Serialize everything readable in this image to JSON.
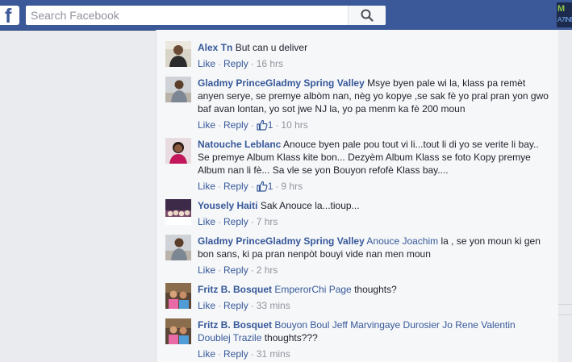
{
  "search": {
    "placeholder": "Search Facebook",
    "logo_letter": "f"
  },
  "corner_badge": {
    "line1": "M",
    "line2": "A7INE"
  },
  "actions": {
    "like": "Like",
    "reply": "Reply",
    "sep": "·"
  },
  "colors": {
    "topbar": "#3b5998",
    "link": "#365899",
    "meta": "#90949c",
    "panel": "#f6f7f9"
  },
  "comments": [
    {
      "author": "Alex Tn",
      "text": "But can u deliver",
      "likes": "",
      "time": "16 hrs"
    },
    {
      "author": "Gladmy PrinceGladmy Spring Valley",
      "text": "Msye byen pale wi la, klass pa remèt anyen serye, se premye albòm nan, nèg yo kopye ,se sak fè yo pral pran yon gwo baf avan lontan, yo sot jwe NJ la, yo pa menm ka fè 200 moun",
      "likes": "1",
      "time": "10 hrs"
    },
    {
      "author": "Natouche Leblanc",
      "text": "Anouce byen pale pou tout vi li...tout li di yo se verite li bay.. Se premye Album Klass kite bon... Dezyèm Album Klass se foto Kopy premye Album nan li fè... Sa vle se yon Bouyon refofè Klass bay....",
      "likes": "1",
      "time": "9 hrs"
    },
    {
      "author": "Yousely Haiti",
      "text": "Sak Anouce la...tioup...",
      "likes": "",
      "time": "7 hrs"
    },
    {
      "author": "Gladmy PrinceGladmy Spring Valley",
      "tag": "Anouce Joachim",
      "text": " la , se yon moun ki gen bon sans, ki pa pran nenpòt bouyi vide nan men moun",
      "likes": "",
      "time": "2 hrs"
    },
    {
      "author": "Fritz B. Bosquet",
      "tag": "EmperorChi Page",
      "text": " thoughts?",
      "likes": "",
      "time": "33 mins"
    },
    {
      "author": "Fritz B. Bosquet",
      "tag": "Bouyon Boul Jeff Marvingaye Durosier Jo Rene Valentin Doublej Trazile",
      "text": " thoughts???",
      "likes": "",
      "time": "31 mins"
    }
  ]
}
